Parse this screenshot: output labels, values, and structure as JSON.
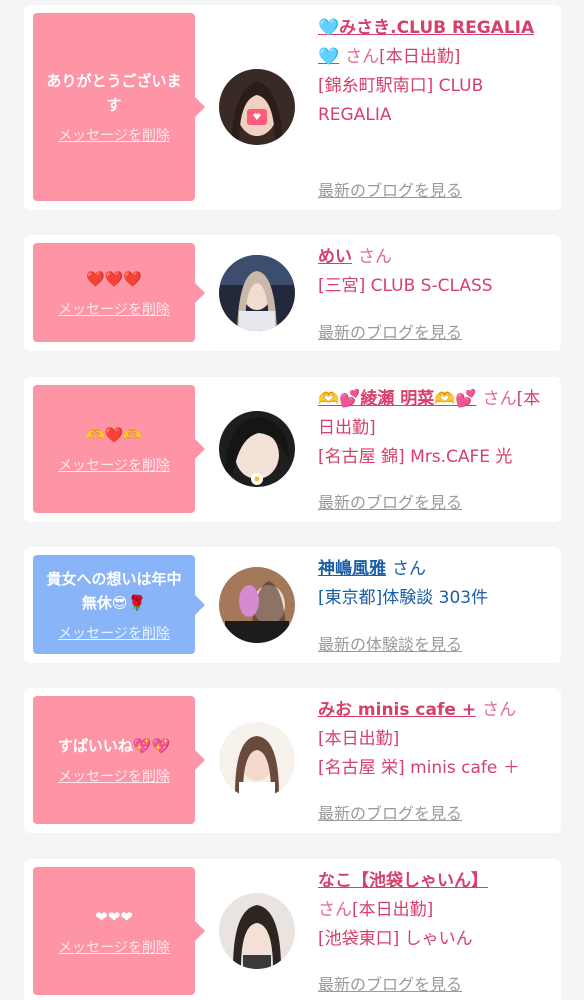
{
  "colors": {
    "pink_bubble": "#fd95a7",
    "blue_bubble": "#8ab4f8",
    "pink_text": "#d6406a",
    "blue_text": "#1a5fa6",
    "link_gray": "#9a9a9a"
  },
  "delete_label": "メッセージを削除",
  "san_label": "さん",
  "entries": [
    {
      "message": "ありがとうございます",
      "name": "🩵みさき.CLUB REGALIA🩵",
      "details": "[本日出勤]",
      "location": "[錦糸町駅南口] CLUB REGALIA",
      "link": "最新のブログを見る"
    },
    {
      "message": "❤️❤️❤️",
      "name": "めい",
      "details": "",
      "location": "[三宮] CLUB S-CLASS",
      "link": "最新のブログを見る"
    },
    {
      "message": "🫶❤️🫶",
      "name": "🫶💕綾瀬 明菜🫶💕",
      "details": "[本日出勤]",
      "location": "[名古屋 錦] Mrs.CAFE 光",
      "link": "最新のブログを見る"
    },
    {
      "message": "貴女への想いは年中無休😎🌹",
      "name": "神嶋風雅",
      "details": "",
      "location": "[東京都]体験談 303件",
      "link": "最新の体験談を見る"
    },
    {
      "message": "すぱいいね💖💖",
      "name": "みお minis cafe +",
      "details": "[本日出勤]",
      "location": "[名古屋 栄] minis cafe ＋",
      "link": "最新のブログを見る"
    },
    {
      "message": "❤❤❤",
      "name": "なこ【池袋しゃいん】",
      "details": "[本日出勤]",
      "location": "[池袋東口] しゃいん",
      "link": "最新のブログを見る"
    }
  ]
}
